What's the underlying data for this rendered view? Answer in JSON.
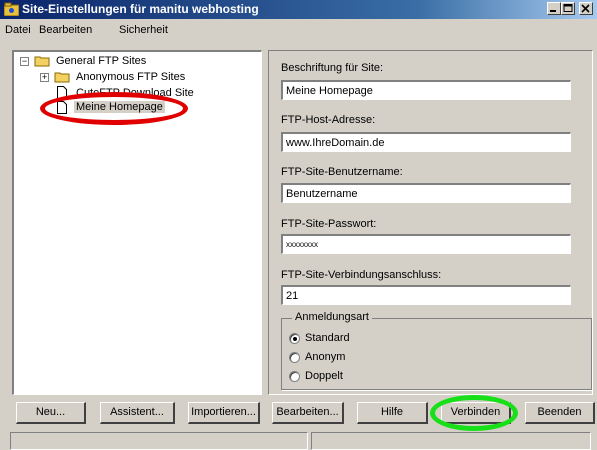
{
  "window": {
    "title": "Site-Einstellungen für manitu webhosting",
    "controls": [
      "minimize",
      "maximize",
      "close"
    ]
  },
  "menu": [
    "Datei",
    "Bearbeiten",
    "Sicherheit"
  ],
  "tree": {
    "root": "General FTP Sites",
    "items": [
      {
        "label": "Anonymous FTP Sites",
        "icon": "folder-icon"
      },
      {
        "label": "CuteFTP Download Site",
        "icon": "page-icon"
      },
      {
        "label": "Meine Homepage",
        "icon": "page-icon",
        "selected": true
      }
    ]
  },
  "form": {
    "caption_label": "Beschriftung für Site:",
    "caption_value": "Meine Homepage",
    "host_label": "FTP-Host-Adresse:",
    "host_value": "www.IhreDomain.de",
    "user_label": "FTP-Site-Benutzername:",
    "user_value": "Benutzername",
    "password_label": "FTP-Site-Passwort:",
    "password_value": "xxxxxxxx",
    "port_label": "FTP-Site-Verbindungsanschluss:",
    "port_value": "21"
  },
  "login": {
    "title": "Anmeldungsart",
    "options": [
      {
        "label": "Standard",
        "checked": true
      },
      {
        "label": "Anonym",
        "checked": false
      },
      {
        "label": "Doppelt",
        "checked": false
      }
    ]
  },
  "buttons": {
    "new": "Neu...",
    "wizard": "Assistent...",
    "import": "Importieren...",
    "edit": "Bearbeiten...",
    "help": "Hilfe",
    "connect": "Verbinden",
    "exit": "Beenden"
  },
  "colors": {
    "titlebar": "#0a246a",
    "highlight_oval": "#e00000",
    "connect_oval": "#18e018"
  }
}
